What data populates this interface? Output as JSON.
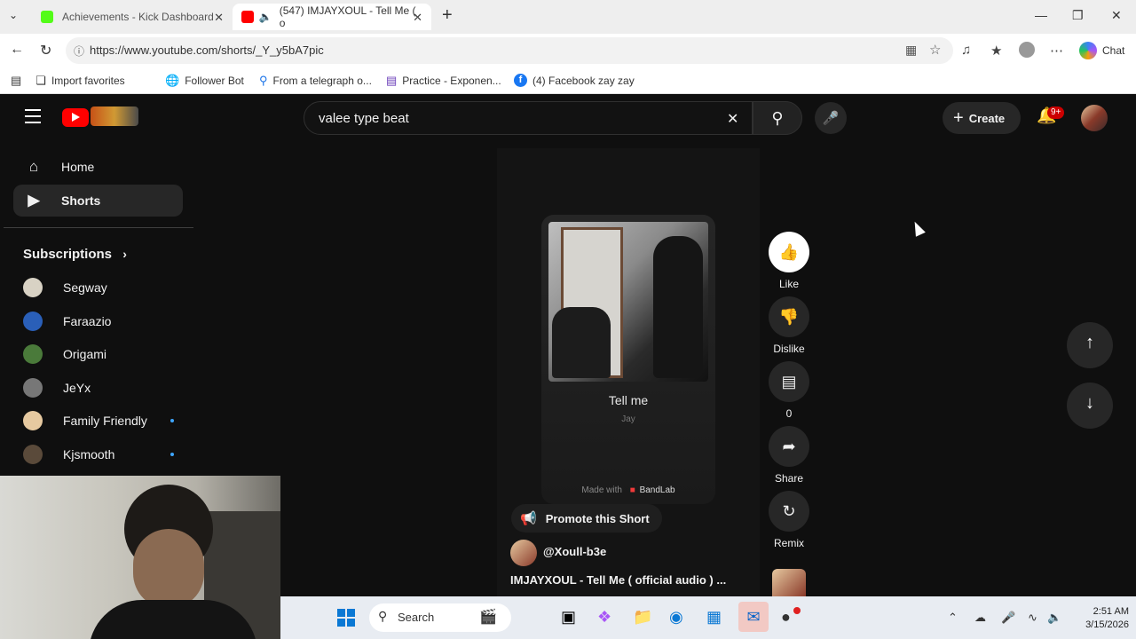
{
  "browser": {
    "tabs": [
      {
        "title": "Achievements - Kick Dashboard",
        "active": false,
        "favicon_color": "#53fc18"
      },
      {
        "title": "(547) IMJAYXOUL - Tell Me ( o",
        "active": true,
        "favicon_color": "#ff0000"
      }
    ],
    "url": "https://www.youtube.com/shorts/_Y_y5bA7pic",
    "chat_label": "Chat",
    "favorites": [
      {
        "label": "Import favorites",
        "icon": "import-icon"
      },
      {
        "label": "Follower Bot",
        "icon": "globe-icon"
      },
      {
        "label": "From a telegraph o...",
        "icon": "search-icon"
      },
      {
        "label": "Practice - Exponen...",
        "icon": "form-icon"
      },
      {
        "label": "(4) Facebook zay zay",
        "icon": "facebook-icon"
      }
    ]
  },
  "youtube": {
    "search_query": "valee type beat",
    "create_label": "Create",
    "notification_badge": "9+",
    "sidebar": {
      "items": [
        {
          "label": "Home",
          "icon": "home-icon"
        },
        {
          "label": "Shorts",
          "icon": "shorts-icon"
        }
      ],
      "subscriptions_label": "Subscriptions",
      "subscriptions": [
        {
          "name": "Segway",
          "color": "#d8d2c4",
          "new": false
        },
        {
          "name": "Faraazio",
          "color": "#2a5fb8",
          "new": false
        },
        {
          "name": "Origami",
          "color": "#4a7a3a",
          "new": false
        },
        {
          "name": "JeYx",
          "color": "#777777",
          "new": false
        },
        {
          "name": "Family Friendly",
          "color": "#e6c9a0",
          "new": true
        },
        {
          "name": "Kjsmooth",
          "color": "#5a4a3a",
          "new": true
        }
      ]
    },
    "short": {
      "song_title": "Tell me",
      "artist": "Jay",
      "made_with": "Made with",
      "made_with_brand": "BandLab",
      "promote_label": "Promote this Short",
      "channel": "@Xoull-b3e",
      "video_title": "IMJAYXOUL - Tell Me ( official audio ) ..."
    },
    "actions": [
      {
        "label": "Like",
        "icon": "thumbs-up-icon"
      },
      {
        "label": "Dislike",
        "icon": "thumbs-down-icon"
      },
      {
        "label": "0",
        "icon": "comment-icon"
      },
      {
        "label": "Share",
        "icon": "share-icon"
      },
      {
        "label": "Remix",
        "icon": "remix-icon"
      }
    ]
  },
  "taskbar": {
    "search_label": "Search",
    "time": "2:51 AM",
    "date": "3/15/2026"
  }
}
